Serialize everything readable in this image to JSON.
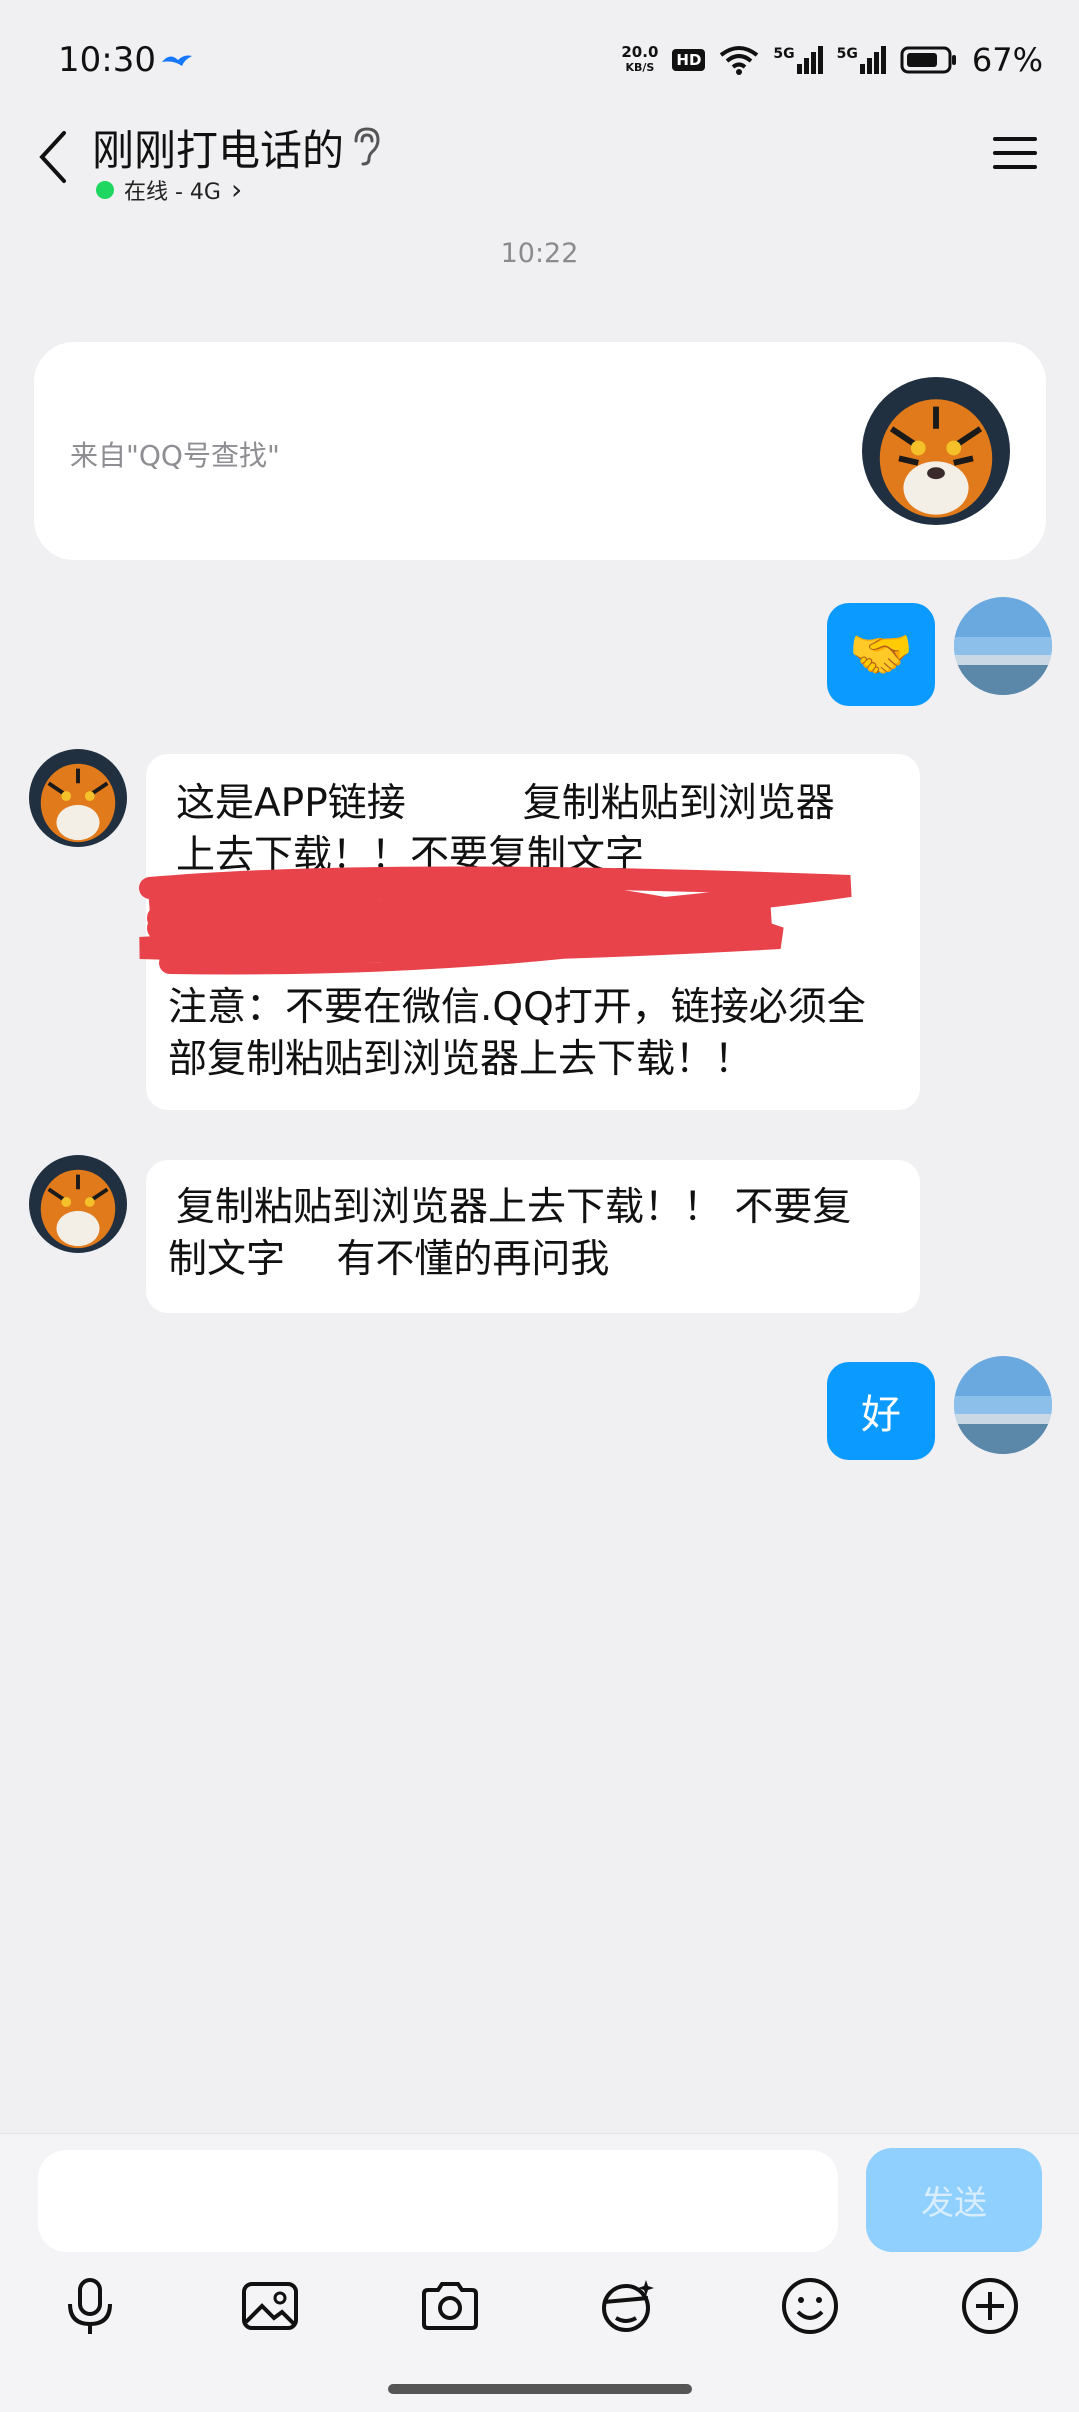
{
  "status": {
    "time": "10:30",
    "net_speed_value": "20.0",
    "net_speed_unit": "KB/S",
    "hd": "HD",
    "sig1": "5G",
    "sig2": "5G",
    "battery": "67%"
  },
  "header": {
    "title": "刚刚打电话的",
    "status_text": "在线 - 4G",
    "chevron": "›"
  },
  "timestamp": "10:22",
  "card": {
    "text": "来自\"QQ号查找\""
  },
  "messages": {
    "m1": {
      "emoji": "🤝"
    },
    "m2": {
      "line1": "这是APP链接　　　复制粘贴到浏览器",
      "line2": "上去下载！！不要复制文字",
      "line3": "注意：不要在微信.QQ打开，链接必须全",
      "line4": "部复制粘贴到浏览器上去下载！！"
    },
    "m3": {
      "line1": "复制粘贴到浏览器上去下载！！ 不要复",
      "line2": "制文字　 有不懂的再问我"
    },
    "m4": {
      "text": "好"
    }
  },
  "input": {
    "send_label": "发送"
  },
  "toolbar": [
    "microphone-icon",
    "image-icon",
    "camera-icon",
    "sticker-icon",
    "emoji-icon",
    "plus-icon"
  ],
  "colors": {
    "accent": "#0b9aff",
    "online": "#1ed760",
    "send_disabled": "#8fd0ff"
  }
}
